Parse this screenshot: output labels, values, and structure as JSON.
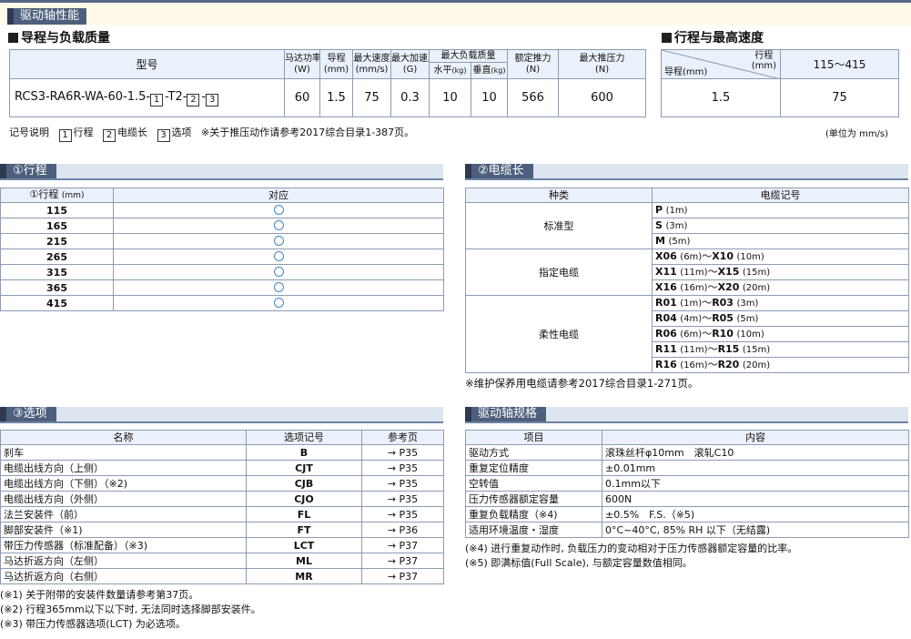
{
  "top_label": "驱动轴性能",
  "lead_load": {
    "title": "导程与负载质量",
    "headers": {
      "model": "型号",
      "motor": "马达功率",
      "motor_unit": "(W)",
      "lead": "导程",
      "lead_unit": "(mm)",
      "max_speed": "最大速度",
      "max_speed_unit": "(mm/s)",
      "max_acc": "最大加速度",
      "max_acc_unit": "(G)",
      "max_load": "最大负载质量",
      "horizontal": "水平",
      "horizontal_unit": "(kg)",
      "vertical": "垂直",
      "vertical_unit": "(kg)",
      "rated_thrust": "额定推力",
      "rated_thrust_unit": "(N)",
      "max_thrust": "最大推压力",
      "max_thrust_unit": "(N)"
    },
    "row": {
      "model_prefix": "RCS3-RA6R-WA-60-1.5-",
      "m1": "1",
      "m_sep1": "-T2-",
      "m2": "2",
      "m_sep2": "-",
      "m3": "3",
      "motor": "60",
      "lead": "1.5",
      "max_speed": "75",
      "max_acc": "0.3",
      "horizontal": "10",
      "vertical": "10",
      "rated_thrust": "566",
      "max_thrust": "600"
    },
    "legend_label": "记号说明",
    "legend_items": [
      {
        "num": "1",
        "text": "行程"
      },
      {
        "num": "2",
        "text": "电缆长"
      },
      {
        "num": "3",
        "text": "选项"
      }
    ],
    "legend_note": "※关于推压动作请参考2017综合目录1-387页。"
  },
  "stroke_speed": {
    "title": "行程与最高速度",
    "header_stroke": "行程",
    "header_stroke_unit": "(mm)",
    "header_lead": "导程(mm)",
    "stroke_range": "115～415",
    "lead": "1.5",
    "speed": "75",
    "unit_note": "(单位为 mm/s)"
  },
  "stroke_section": {
    "label": "①行程",
    "header_stroke": "①行程",
    "header_unit": "(mm)",
    "header_support": "对应",
    "rows": [
      "115",
      "165",
      "215",
      "265",
      "315",
      "365",
      "415"
    ]
  },
  "cable_section": {
    "label": "②电缆长",
    "header_type": "种类",
    "header_code": "电缆记号",
    "groups": [
      {
        "type": "标准型",
        "rows": [
          {
            "c1": "P",
            "l1": "(1m)",
            "c2": "",
            "l2": ""
          },
          {
            "c1": "S",
            "l1": "(3m)",
            "c2": "",
            "l2": ""
          },
          {
            "c1": "M",
            "l1": "(5m)",
            "c2": "",
            "l2": ""
          }
        ]
      },
      {
        "type": "指定电缆",
        "rows": [
          {
            "c1": "X06",
            "l1": "(6m)",
            "c2": "X10",
            "l2": "(10m)"
          },
          {
            "c1": "X11",
            "l1": "(11m)",
            "c2": "X15",
            "l2": "(15m)"
          },
          {
            "c1": "X16",
            "l1": "(16m)",
            "c2": "X20",
            "l2": "(20m)"
          }
        ]
      },
      {
        "type": "柔性电缆",
        "rows": [
          {
            "c1": "R01",
            "l1": "(1m)",
            "c2": "R03",
            "l2": "(3m)"
          },
          {
            "c1": "R04",
            "l1": "(4m)",
            "c2": "R05",
            "l2": "(5m)"
          },
          {
            "c1": "R06",
            "l1": "(6m)",
            "c2": "R10",
            "l2": "(10m)"
          },
          {
            "c1": "R11",
            "l1": "(11m)",
            "c2": "R15",
            "l2": "(15m)"
          },
          {
            "c1": "R16",
            "l1": "(16m)",
            "c2": "R20",
            "l2": "(20m)"
          }
        ]
      }
    ],
    "tilde": "～",
    "note": "※维护保养用电缆请参考2017综合目录1-271页。"
  },
  "option_section": {
    "label": "③选项",
    "header_name": "名称",
    "header_code": "选项记号",
    "header_page": "参考页",
    "rows": [
      {
        "name": "刹车",
        "code": "B",
        "page": "→ P35"
      },
      {
        "name": "电缆出线方向（上侧）",
        "code": "CJT",
        "page": "→ P35"
      },
      {
        "name": "电缆出线方向（下侧）（※2)",
        "code": "CJB",
        "page": "→ P35"
      },
      {
        "name": "电缆出线方向（外侧）",
        "code": "CJO",
        "page": "→ P35"
      },
      {
        "name": "法兰安装件（前）",
        "code": "FL",
        "page": "→ P35"
      },
      {
        "name": "脚部安装件（※1)",
        "code": "FT",
        "page": "→ P36"
      },
      {
        "name": "带压力传感器（标准配备）（※3)",
        "code": "LCT",
        "page": "→ P37"
      },
      {
        "name": "马达折返方向（左侧）",
        "code": "ML",
        "page": "→ P37"
      },
      {
        "name": "马达折返方向（右侧）",
        "code": "MR",
        "page": "→ P37"
      }
    ],
    "notes": [
      "(※1) 关于附带的安装件数量请参考第37页。",
      "(※2) 行程365mm以下以下时, 无法同时选择脚部安装件。",
      "(※3) 带压力传感器选项(LCT) 为必选项。"
    ]
  },
  "spec_section": {
    "label": "驱动轴规格",
    "header_item": "项目",
    "header_content": "内容",
    "rows": [
      {
        "item": "驱动方式",
        "content": "滚珠丝杆φ10mm　滚轧C10"
      },
      {
        "item": "重复定位精度",
        "content": "±0.01mm"
      },
      {
        "item": "空转值",
        "content": "0.1mm以下"
      },
      {
        "item": "压力传感器额定容量",
        "content": "600N"
      },
      {
        "item": "重复负载精度（※4)",
        "content": "±0.5%　F.S.（※5)"
      },
      {
        "item": "适用环境温度・湿度",
        "content": "0°C~40°C, 85% RH 以下（无结露)"
      }
    ],
    "notes": [
      "(※4) 进行重复动作时, 负载压力的变动相对于压力传感器额定容量的比率。",
      "(※5) 即满标值(Full Scale), 与额定容量数值相同。"
    ]
  }
}
